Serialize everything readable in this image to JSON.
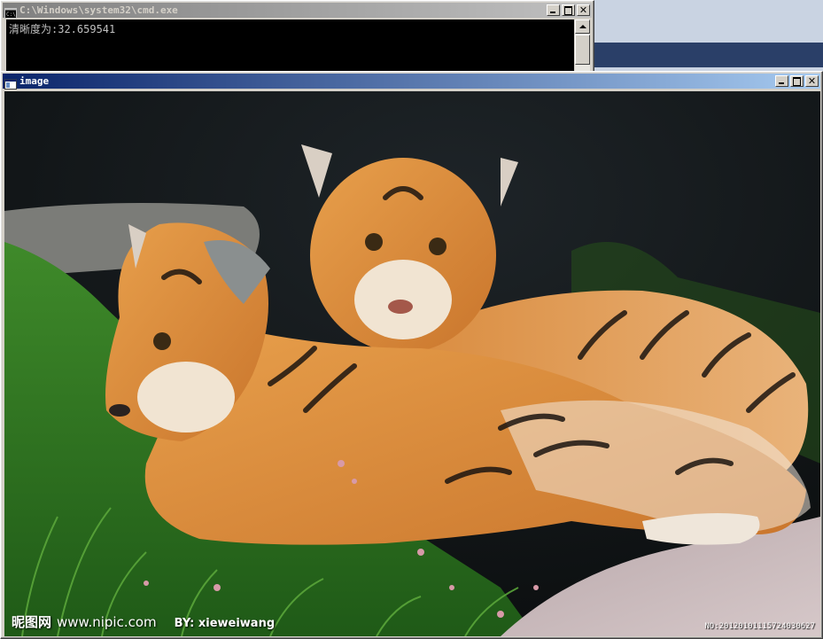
{
  "cmd_window": {
    "title": "C:\\Windows\\system32\\cmd.exe",
    "output_line": "清晰度为:32.659541"
  },
  "image_window": {
    "title": "image",
    "photo_subject": "two-tiger-cubs-photo",
    "watermark": {
      "brand": "昵图网",
      "url": "www.nipic.com",
      "author": "BY: xieweiwang",
      "image_id": "NO:20120101115724030627"
    }
  },
  "colors": {
    "active_title": "#0a246a",
    "inactive_title": "#808080",
    "window_face": "#d4d0c8",
    "console_bg": "#000000",
    "console_text": "#c0c0c0"
  },
  "icons": [
    "console-icon",
    "image-window-icon",
    "minimize-icon",
    "maximize-icon",
    "close-icon",
    "scroll-up-icon"
  ]
}
